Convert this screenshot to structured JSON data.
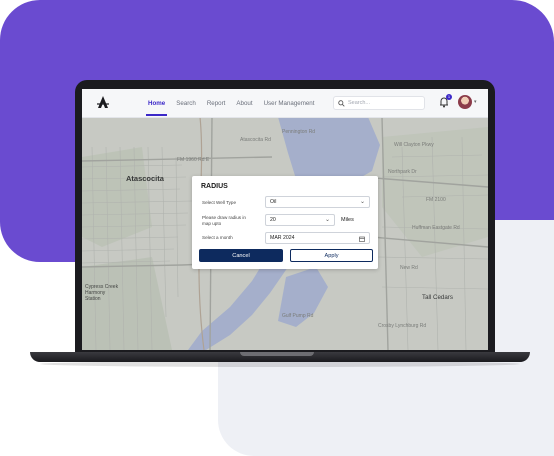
{
  "nav": {
    "links": [
      "Home",
      "Search",
      "Report",
      "About",
      "User Management"
    ],
    "search_placeholder": "Search...",
    "notification_count": "1"
  },
  "map": {
    "labels": {
      "atascocita": "Atascocita",
      "tall_cedars": "Tall Cedars",
      "fm1960": "FM 1960 Rd E",
      "atascocita_rd": "Atascocita Rd",
      "lake_houston_pkwy": "Lake Houston Pkwy",
      "pennington": "Pennington Rd",
      "cypress_creek": "Cypress Creek",
      "harmony": "Harmony",
      "station": "Station",
      "will_clayton": "Will Clayton Pkwy",
      "north_park": "Northpark Dr",
      "huffman": "Huffman Eastgate Rd",
      "crosby": "Crosby Lynchburg Rd",
      "gulf": "Gulf Pump Rd",
      "new_rd": "New Rd",
      "fm2100": "FM 2100"
    }
  },
  "modal": {
    "title": "RADIUS",
    "well_type_label": "Select Well Type",
    "well_type_value": "Oil",
    "radius_label": "Please draw radius in map upto",
    "radius_value": "20",
    "radius_unit": "Miles",
    "month_label": "Select a month",
    "month_value": "MAR 2024",
    "cancel_label": "Cancel",
    "apply_label": "Apply"
  },
  "colors": {
    "brand_purple": "#6a4bd0",
    "nav_active": "#3b28c8",
    "primary_button": "#0d2a5e"
  }
}
